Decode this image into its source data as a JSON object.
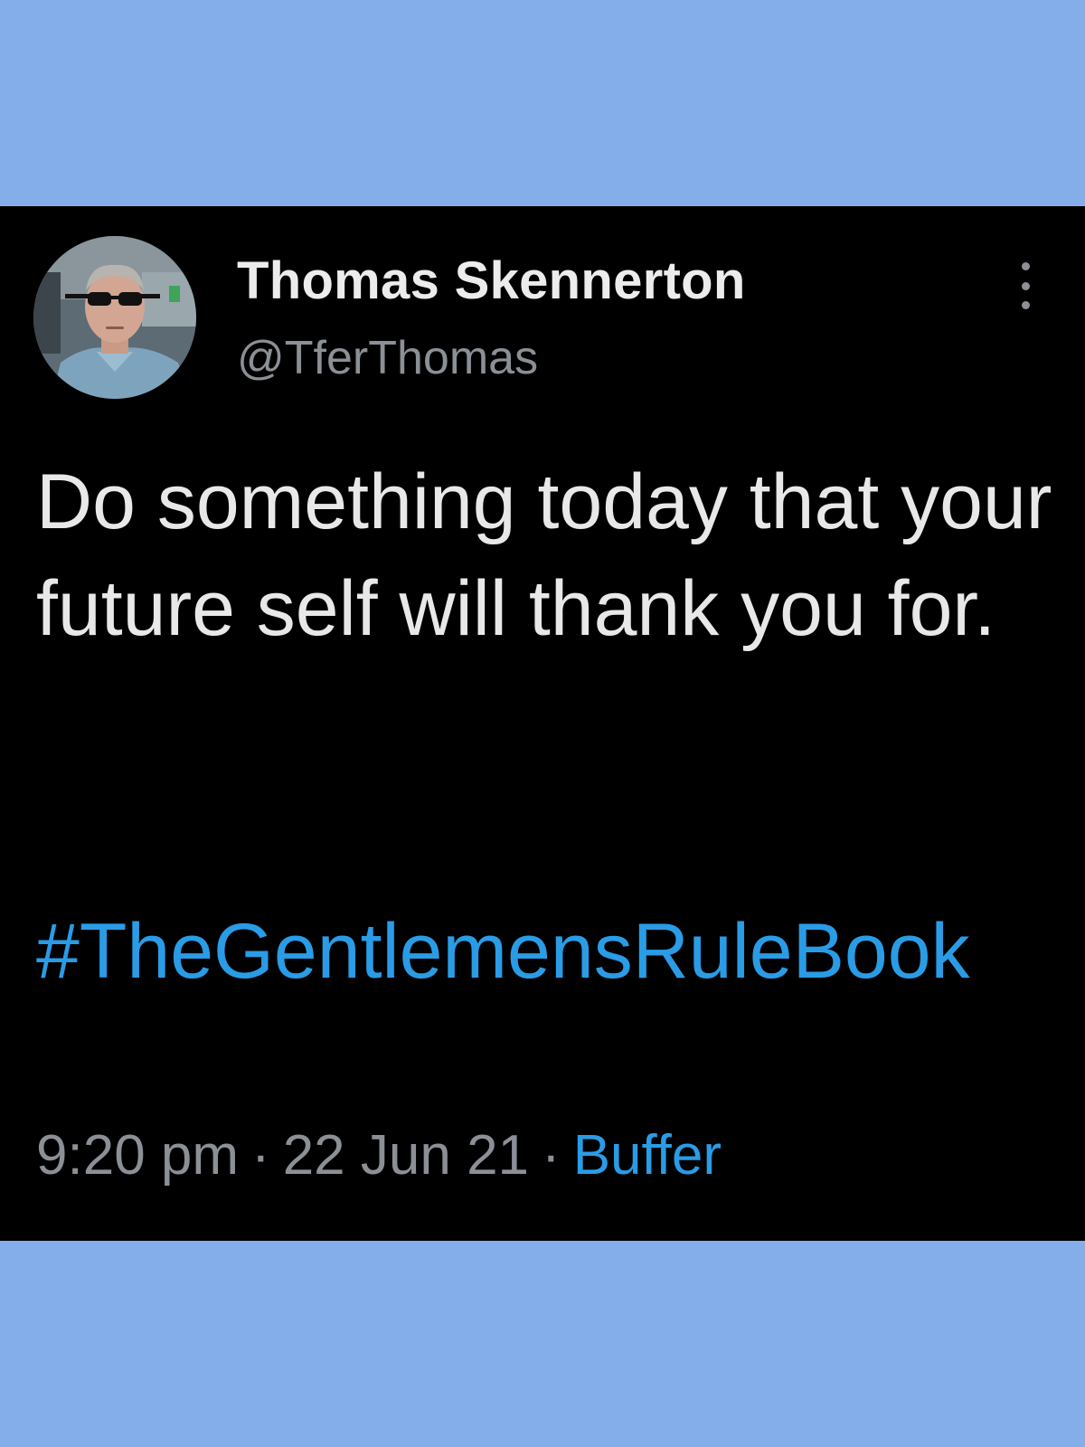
{
  "tweet": {
    "display_name": "Thomas Skennerton",
    "handle": "@TferThomas",
    "text": "Do something today that your future self will thank you for.",
    "hashtag": "#TheGentlemensRuleBook",
    "time": "9:20 pm",
    "date": "22 Jun 21",
    "separator": "·",
    "source": "Buffer",
    "more_icon": "more-vertical-icon",
    "avatar_description_icon": "profile-photo"
  },
  "colors": {
    "page_background": "#84aeea",
    "card_background": "#000000",
    "primary_text": "#e8e8e8",
    "secondary_text": "#8b9096",
    "link": "#2a9ce6"
  }
}
